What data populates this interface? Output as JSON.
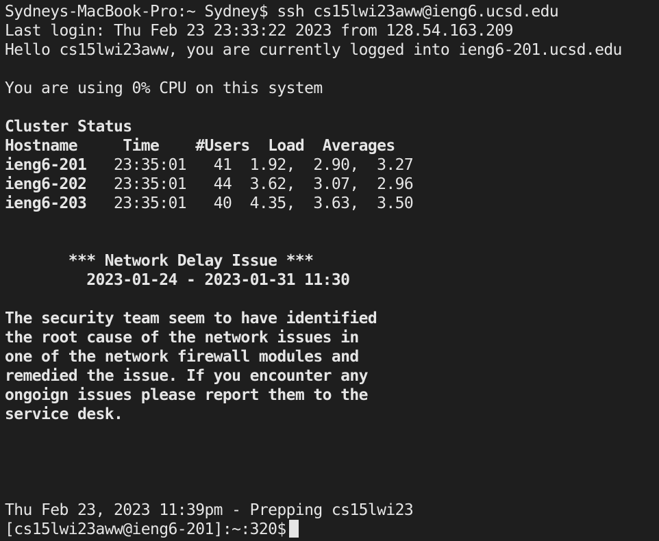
{
  "terminal": {
    "lines": [
      {
        "text": "Sydneys-MacBook-Pro:~ Sydney$ ssh cs15lwi23aww@ieng6.ucsd.edu",
        "bold": false
      },
      {
        "text": "Last login: Thu Feb 23 23:33:22 2023 from 128.54.163.209",
        "bold": false
      },
      {
        "text": "Hello cs15lwi23aww, you are currently logged into ieng6-201.ucsd.edu",
        "bold": false
      },
      {
        "text": "",
        "bold": false
      },
      {
        "text": "You are using 0% CPU on this system",
        "bold": false
      },
      {
        "text": "",
        "bold": false
      },
      {
        "text": "Cluster Status",
        "bold": true
      },
      {
        "text": "Hostname     Time    #Users  Load  Averages",
        "bold": true
      },
      {
        "text": "ieng6-201   23:35:01   41  1.92,  2.90,  3.27",
        "bold": false,
        "host_bold": "ieng6-201",
        "rest": "   23:35:01   41  1.92,  2.90,  3.27"
      },
      {
        "text": "ieng6-202   23:35:01   44  3.62,  3.07,  2.96",
        "bold": false,
        "host_bold": "ieng6-202",
        "rest": "   23:35:01   44  3.62,  3.07,  2.96"
      },
      {
        "text": "ieng6-203   23:35:01   40  4.35,  3.63,  3.50",
        "bold": false,
        "host_bold": "ieng6-203",
        "rest": "   23:35:01   40  4.35,  3.63,  3.50"
      },
      {
        "text": "",
        "bold": false
      },
      {
        "text": "",
        "bold": false
      },
      {
        "text": "       *** Network Delay Issue ***",
        "bold": true
      },
      {
        "text": "         2023-01-24 - 2023-01-31 11:30",
        "bold": true
      },
      {
        "text": "",
        "bold": false
      },
      {
        "text": "The security team seem to have identified",
        "bold": true
      },
      {
        "text": "the root cause of the network issues in",
        "bold": true
      },
      {
        "text": "one of the network firewall modules and",
        "bold": true
      },
      {
        "text": "remedied the issue. If you encounter any",
        "bold": true
      },
      {
        "text": "ongoign issues please report them to the",
        "bold": true
      },
      {
        "text": "service desk.",
        "bold": true
      },
      {
        "text": "",
        "bold": false
      },
      {
        "text": "",
        "bold": false
      },
      {
        "text": "",
        "bold": false
      },
      {
        "text": "",
        "bold": false
      },
      {
        "text": "Thu Feb 23, 2023 11:39pm - Prepping cs15lwi23",
        "bold": false
      }
    ],
    "prompt": "[cs15lwi23aww@ieng6-201]:~:320$"
  }
}
